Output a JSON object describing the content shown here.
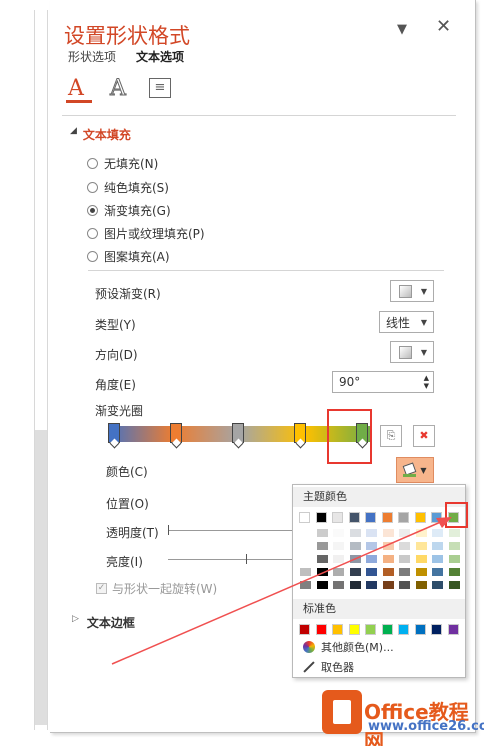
{
  "panel": {
    "title": "设置形状格式",
    "tabs": [
      "形状选项",
      "文本选项"
    ],
    "close_glyph": "✕",
    "pin_glyph": "▼"
  },
  "icons": {
    "text_fill_outline": "A",
    "text_effects": "A",
    "textbox": "≡"
  },
  "text_fill": {
    "header": "文本填充",
    "options": [
      "无填充(N)",
      "纯色填充(S)",
      "渐变填充(G)",
      "图片或纹理填充(P)",
      "图案填充(A)"
    ],
    "selected_index": 2
  },
  "gradient": {
    "preset_label": "预设渐变(R)",
    "type_label": "类型(Y)",
    "type_value": "线性",
    "direction_label": "方向(D)",
    "angle_label": "角度(E)",
    "angle_value": "90°",
    "stops_label": "渐变光圈",
    "color_label": "颜色(C)",
    "position_label": "位置(O)",
    "transparency_label": "透明度(T)",
    "brightness_label": "亮度(I)",
    "rotate_label": "与形状一起旋转(W)",
    "stop_colors": [
      "#4472c4",
      "#ed7d31",
      "#a5a5a5",
      "#ffc000",
      "#70ad47"
    ]
  },
  "text_border": {
    "header": "文本边框"
  },
  "color_dropdown": {
    "theme_header": "主题颜色",
    "standard_header": "标准色",
    "more_colors": "其他颜色(M)...",
    "eyedropper": "取色器",
    "theme_colors": [
      "#ffffff",
      "#000000",
      "#e7e6e6",
      "#44546a",
      "#4472c4",
      "#ed7d31",
      "#a5a5a5",
      "#ffc000",
      "#5b9bd5",
      "#70ad47"
    ],
    "standard_colors": [
      "#c00000",
      "#ff0000",
      "#ffc000",
      "#ffff00",
      "#92d050",
      "#00b050",
      "#00b0f0",
      "#0070c0",
      "#002060",
      "#7030a0"
    ]
  },
  "watermark": {
    "brand": "Office教程网",
    "url": "www.office26.com"
  },
  "colors": {
    "accent": "#d24726",
    "highlight_red": "#e8382f"
  }
}
